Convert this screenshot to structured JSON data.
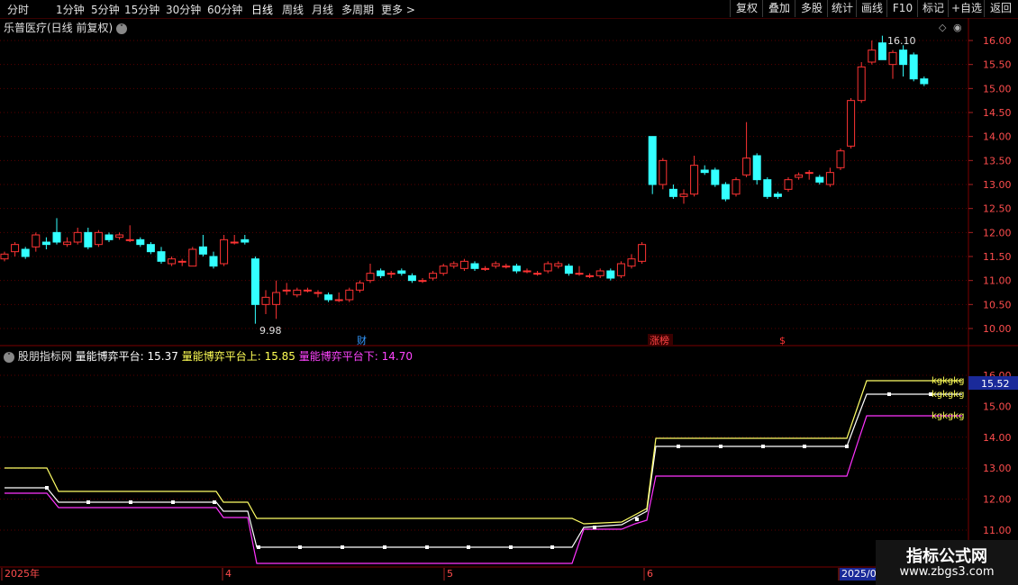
{
  "toolbar": {
    "periods": [
      "分时",
      "1分钟",
      "5分钟",
      "15分钟",
      "30分钟",
      "60分钟",
      "日线",
      "周线",
      "月线",
      "多周期",
      "更多 >"
    ],
    "tools": [
      "复权",
      "叠加",
      "多股",
      "统计",
      "画线",
      "F10",
      "标记",
      "+自选",
      "返回"
    ]
  },
  "main_chart": {
    "title": "乐普医疗(日线 前复权)",
    "y_ticks": [
      "16.00",
      "15.50",
      "15.00",
      "14.50",
      "14.00",
      "13.50",
      "13.00",
      "12.50",
      "12.00",
      "11.50",
      "11.00",
      "10.50",
      "10.00"
    ],
    "high_label": "16.10",
    "low_label": "9.98",
    "markers": [
      {
        "text": "财",
        "color": "#3399ff"
      },
      {
        "text": "涨榜",
        "color": "#ff4444"
      },
      {
        "text": "$",
        "color": "#ff3333"
      }
    ]
  },
  "indicator": {
    "name": "股朋指标网",
    "line1_label": "量能博弈平台: 15.37",
    "line2_label": "量能博弈平台上: 15.85",
    "line3_label": "量能博弈平台下: 14.70",
    "y_ticks": [
      "16.00",
      "15.00",
      "14.00",
      "13.00",
      "12.00",
      "11.00"
    ],
    "current_value": "15.52",
    "end_tag": "kgkgkg",
    "colors": {
      "line1": "#ffffff",
      "line2": "#ffff66",
      "line3": "#ff33ff",
      "up": "#ff3333",
      "down": "#33ffff"
    }
  },
  "x_axis": {
    "labels": [
      "2025年",
      "4",
      "5",
      "6",
      "2025/0"
    ]
  },
  "watermark": {
    "line1": "指标公式网",
    "line2": "www.zbgs3.com"
  },
  "chart_data": [
    {
      "type": "candlestick",
      "title": "乐普医疗(日线 前复权)",
      "ylim": [
        9.8,
        16.4
      ],
      "candles": [
        [
          11.45,
          11.55,
          11.6,
          11.4
        ],
        [
          11.6,
          11.75,
          11.8,
          11.5
        ],
        [
          11.65,
          11.5,
          11.7,
          11.45
        ],
        [
          11.7,
          11.95,
          12.0,
          11.6
        ],
        [
          11.8,
          11.75,
          11.9,
          11.65
        ],
        [
          12.0,
          11.8,
          12.3,
          11.75
        ],
        [
          11.75,
          11.8,
          11.9,
          11.7
        ],
        [
          11.8,
          12.0,
          12.1,
          11.75
        ],
        [
          12.0,
          11.7,
          12.1,
          11.65
        ],
        [
          11.75,
          12.0,
          12.05,
          11.7
        ],
        [
          11.95,
          11.85,
          12.0,
          11.8
        ],
        [
          11.9,
          11.95,
          12.0,
          11.85
        ],
        [
          11.85,
          11.85,
          12.15,
          11.8
        ],
        [
          11.85,
          11.75,
          11.9,
          11.7
        ],
        [
          11.75,
          11.6,
          11.8,
          11.55
        ],
        [
          11.6,
          11.4,
          11.7,
          11.35
        ],
        [
          11.35,
          11.45,
          11.5,
          11.3
        ],
        [
          11.4,
          11.4,
          11.45,
          11.3
        ],
        [
          11.3,
          11.65,
          11.7,
          11.3
        ],
        [
          11.7,
          11.55,
          11.95,
          11.5
        ],
        [
          11.5,
          11.3,
          11.6,
          11.25
        ],
        [
          11.35,
          11.85,
          11.95,
          11.3
        ],
        [
          11.8,
          11.8,
          11.95,
          11.75
        ],
        [
          11.85,
          11.8,
          11.95,
          11.75
        ],
        [
          11.45,
          10.5,
          11.5,
          10.1
        ],
        [
          10.5,
          10.65,
          10.8,
          10.3
        ],
        [
          10.5,
          10.75,
          11.0,
          10.2
        ],
        [
          10.8,
          10.8,
          10.95,
          10.7
        ],
        [
          10.7,
          10.8,
          10.85,
          10.65
        ],
        [
          10.8,
          10.8,
          10.85,
          10.75
        ],
        [
          10.75,
          10.75,
          10.8,
          10.65
        ],
        [
          10.7,
          10.6,
          10.75,
          10.55
        ],
        [
          10.6,
          10.6,
          10.75,
          10.55
        ],
        [
          10.6,
          10.8,
          10.85,
          10.55
        ],
        [
          10.8,
          10.95,
          11.0,
          10.75
        ],
        [
          11.0,
          11.15,
          11.35,
          10.95
        ],
        [
          11.2,
          11.1,
          11.25,
          11.05
        ],
        [
          11.15,
          11.15,
          11.2,
          11.05
        ],
        [
          11.2,
          11.15,
          11.25,
          11.1
        ],
        [
          11.1,
          11.0,
          11.15,
          10.95
        ],
        [
          11.0,
          11.0,
          11.05,
          10.95
        ],
        [
          11.05,
          11.15,
          11.2,
          11.0
        ],
        [
          11.15,
          11.3,
          11.35,
          11.1
        ],
        [
          11.3,
          11.35,
          11.4,
          11.25
        ],
        [
          11.25,
          11.4,
          11.45,
          11.2
        ],
        [
          11.35,
          11.25,
          11.4,
          11.2
        ],
        [
          11.25,
          11.25,
          11.3,
          11.2
        ],
        [
          11.3,
          11.35,
          11.4,
          11.25
        ],
        [
          11.3,
          11.3,
          11.35,
          11.25
        ],
        [
          11.3,
          11.2,
          11.35,
          11.15
        ],
        [
          11.2,
          11.2,
          11.25,
          11.15
        ],
        [
          11.15,
          11.15,
          11.2,
          11.1
        ],
        [
          11.2,
          11.35,
          11.4,
          11.15
        ],
        [
          11.3,
          11.35,
          11.4,
          11.25
        ],
        [
          11.3,
          11.15,
          11.35,
          11.1
        ],
        [
          11.15,
          11.15,
          11.3,
          11.1
        ],
        [
          11.1,
          11.1,
          11.15,
          11.05
        ],
        [
          11.1,
          11.2,
          11.25,
          11.05
        ],
        [
          11.2,
          11.05,
          11.25,
          11.0
        ],
        [
          11.1,
          11.35,
          11.4,
          11.05
        ],
        [
          11.3,
          11.45,
          11.55,
          11.25
        ],
        [
          11.4,
          11.75,
          11.8,
          11.35
        ],
        [
          14.0,
          13.0,
          14.0,
          12.8
        ],
        [
          13.0,
          13.5,
          13.55,
          12.9
        ],
        [
          12.9,
          12.75,
          13.0,
          12.7
        ],
        [
          12.75,
          12.8,
          12.9,
          12.6
        ],
        [
          12.8,
          13.4,
          13.6,
          12.75
        ],
        [
          13.3,
          13.25,
          13.4,
          13.2
        ],
        [
          13.3,
          13.0,
          13.35,
          12.95
        ],
        [
          13.0,
          12.7,
          13.05,
          12.65
        ],
        [
          12.8,
          13.1,
          13.15,
          12.75
        ],
        [
          13.2,
          13.55,
          14.3,
          13.15
        ],
        [
          13.6,
          13.1,
          13.65,
          13.0
        ],
        [
          13.1,
          12.75,
          13.15,
          12.7
        ],
        [
          12.8,
          12.75,
          12.85,
          12.7
        ],
        [
          12.9,
          13.1,
          13.15,
          12.85
        ],
        [
          13.15,
          13.2,
          13.25,
          13.1
        ],
        [
          13.25,
          13.25,
          13.3,
          13.1
        ],
        [
          13.15,
          13.05,
          13.2,
          13.0
        ],
        [
          13.0,
          13.25,
          13.35,
          12.95
        ],
        [
          13.35,
          13.7,
          13.75,
          13.3
        ],
        [
          13.8,
          14.75,
          14.8,
          13.75
        ],
        [
          14.75,
          15.45,
          15.55,
          14.7
        ],
        [
          15.55,
          15.8,
          16.0,
          15.5
        ],
        [
          15.95,
          15.6,
          16.1,
          15.6
        ],
        [
          15.5,
          15.75,
          15.8,
          15.2
        ],
        [
          15.8,
          15.5,
          15.9,
          15.25
        ],
        [
          15.7,
          15.2,
          15.75,
          15.15
        ],
        [
          15.2,
          15.1,
          15.25,
          15.05
        ]
      ]
    },
    {
      "type": "line",
      "title": "股朋指标网",
      "ylim": [
        10.6,
        16.5
      ],
      "series": [
        {
          "name": "量能博弈平台",
          "values": [
            12.4,
            12.4,
            12.4,
            12.4,
            12.4,
            12.4,
            12.4,
            12.4,
            12.4,
            12.4,
            12.4,
            12.4,
            12.4,
            12.4,
            12.4,
            12.4,
            12.4,
            12.4,
            12.4,
            12.4,
            12.4,
            12.4,
            12.4,
            12.4,
            10.9,
            10.9,
            10.9,
            10.9,
            10.9,
            10.9,
            10.9,
            10.9,
            10.9,
            10.9,
            10.9,
            10.9,
            10.9,
            10.9,
            10.9,
            10.9,
            10.9,
            10.9,
            10.9,
            10.9,
            10.9,
            10.9,
            10.9,
            10.9,
            10.9,
            10.9,
            10.9,
            10.9,
            10.9,
            11.5,
            11.7,
            13.7,
            13.7,
            13.7,
            13.7,
            13.7,
            13.7,
            13.7,
            13.7,
            13.7,
            13.7,
            13.7,
            13.7,
            13.7,
            13.7,
            15.4,
            15.4,
            15.4,
            15.4,
            15.4,
            15.4,
            15.4,
            15.4,
            15.4,
            15.4,
            15.4,
            15.4,
            15.4,
            15.4,
            15.4,
            15.4,
            15.4,
            15.4,
            15.4,
            15.4
          ],
          "plot": [
            [
              5,
              542
            ],
            [
              52,
              542
            ],
            [
              65,
              558
            ],
            [
              240,
              558
            ],
            [
              248,
              568
            ],
            [
              275,
              568
            ],
            [
              285,
              608
            ],
            [
              635,
              608
            ],
            [
              648,
              586
            ],
            [
              690,
              583
            ],
            [
              718,
              568
            ],
            [
              728,
              496
            ],
            [
              940,
              496
            ],
            [
              952,
              464
            ],
            [
              962,
              438
            ],
            [
              1068,
              438
            ]
          ]
        },
        {
          "name": "量能博弈平台上",
          "values": [],
          "plot": [
            [
              5,
              520
            ],
            [
              52,
              520
            ],
            [
              65,
              546
            ],
            [
              240,
              546
            ],
            [
              248,
              558
            ],
            [
              275,
              558
            ],
            [
              285,
              576
            ],
            [
              635,
              576
            ],
            [
              648,
              582
            ],
            [
              690,
              580
            ],
            [
              718,
              565
            ],
            [
              728,
              487
            ],
            [
              940,
              487
            ],
            [
              952,
              452
            ],
            [
              962,
              423
            ],
            [
              1068,
              423
            ]
          ]
        },
        {
          "name": "量能博弈平台下",
          "values": [],
          "plot": [
            [
              5,
              548
            ],
            [
              52,
              548
            ],
            [
              65,
              564
            ],
            [
              240,
              564
            ],
            [
              248,
              575
            ],
            [
              275,
              575
            ],
            [
              285,
              626
            ],
            [
              635,
              626
            ],
            [
              648,
              588
            ],
            [
              690,
              588
            ],
            [
              705,
              582
            ],
            [
              718,
              578
            ],
            [
              728,
              529
            ],
            [
              940,
              529
            ],
            [
              952,
              492
            ],
            [
              962,
              462
            ],
            [
              1068,
              462
            ]
          ]
        }
      ]
    }
  ]
}
